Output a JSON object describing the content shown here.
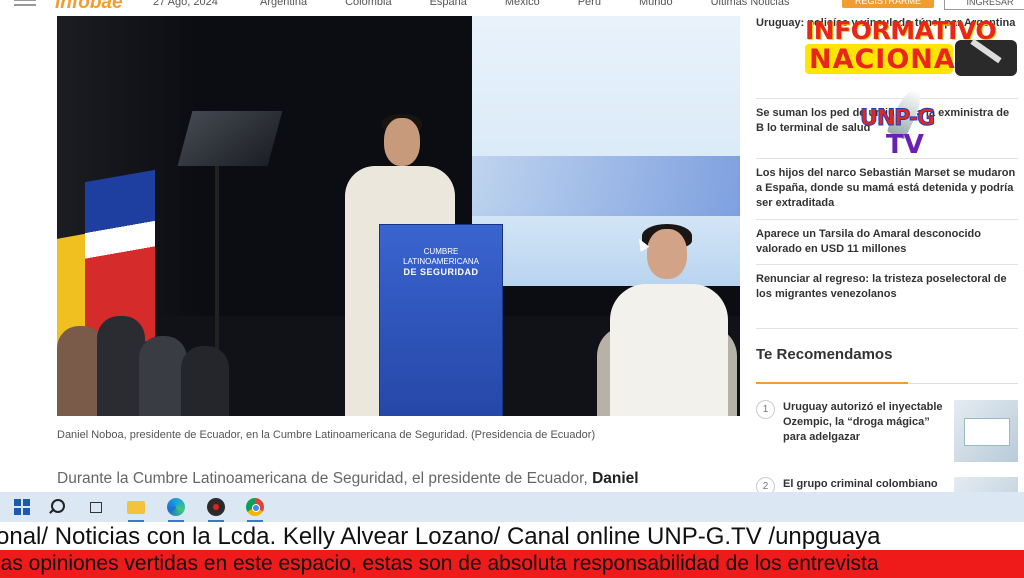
{
  "site": {
    "logo": "Infobae",
    "date": "27 Ago, 2024",
    "nav": [
      "Argentina",
      "Colombia",
      "España",
      "México",
      "Perú",
      "Mundo",
      "Últimas Noticias"
    ],
    "btn_subscribe": "REGISTRARME",
    "btn_login": "INGRESAR"
  },
  "photo": {
    "podium_line1": "CUMBRE",
    "podium_line2": "LATINOAMERICANA",
    "podium_line3": "DE SEGURIDAD"
  },
  "caption": "Daniel Noboa, presidente de Ecuador, en la Cumbre Latinoamericana de Seguridad. (Presidencia de Ecuador)",
  "article": {
    "text": "Durante la Cumbre Latinoamericana de Seguridad, el presidente de Ecuador, ",
    "bold": "Daniel"
  },
  "sidebar": {
    "items": [
      "Uruguay: policías y vinculado túnel par Argentina",
      "Se suman los ped de un juicio a la exministra de B lo terminal de salud",
      "Los hijos del narco Sebastián Marset se mudaron a España, donde su mamá está detenida y podría ser extraditada",
      "Aparece un Tarsila do Amaral desconocido valorado en USD 11 millones",
      "Renunciar al regreso: la tristeza poselectoral de los migrantes venezolanos"
    ],
    "rec_title": "Te Recomendamos",
    "recs": [
      {
        "num": "1",
        "text": "Uruguay autorizó el inyectable Ozempic, la “droga mágica” para adelgazar"
      },
      {
        "num": "2",
        "text": "El grupo criminal colombiano"
      }
    ]
  },
  "overlay": {
    "logo_line1": "INFORMATIVO",
    "logo_line2": "NACIONAL",
    "unpg_line1": "UNP-G",
    "unpg_line2": "TV"
  },
  "ticker": {
    "line1": "onal/ Noticias con la Lcda. Kelly Alvear Lozano/ Canal online UNP-G.TV /unpguaya",
    "line2": "las opiniones vertidas en este espacio, estas son de absoluta responsabilidad de los entrevista"
  }
}
